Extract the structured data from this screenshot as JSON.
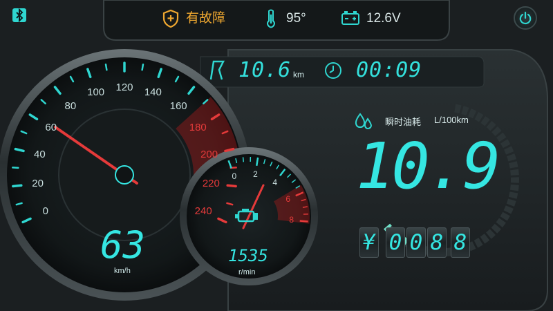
{
  "status_bar": {
    "fault_label": "有故障",
    "temperature": "95°",
    "voltage": "12.6V"
  },
  "trip": {
    "distance": "10.6",
    "distance_unit": "km",
    "time": "00:09"
  },
  "speedometer": {
    "speed": "63",
    "unit": "km/h",
    "ticks": [
      "0",
      "20",
      "40",
      "60",
      "80",
      "100",
      "120",
      "140",
      "160",
      "180",
      "200",
      "220",
      "240"
    ],
    "max": 240
  },
  "tachometer": {
    "rpm": "1535",
    "unit": "r/min",
    "ticks": [
      "0",
      "2",
      "4",
      "6",
      "8"
    ],
    "max": 8
  },
  "consumption": {
    "label": "瞬时油耗",
    "unit": "L/100km",
    "value": "10.9",
    "gauge_fraction": 0.12
  },
  "cost": {
    "currency": "¥",
    "digits": [
      "0",
      "0",
      "8",
      ".",
      "8"
    ]
  },
  "icons": {
    "bluetooth": "bluetooth-icon",
    "shield": "shield-warning-icon",
    "thermometer": "thermometer-icon",
    "battery": "battery-icon",
    "odometer": "road-icon",
    "clock": "clock-icon",
    "fuel_drop": "drops-icon",
    "engine": "engine-check-icon",
    "power": "power-icon"
  },
  "colors": {
    "accent": "#2fd6d0",
    "warning": "#f0a830",
    "redline": "#e02a2a"
  }
}
